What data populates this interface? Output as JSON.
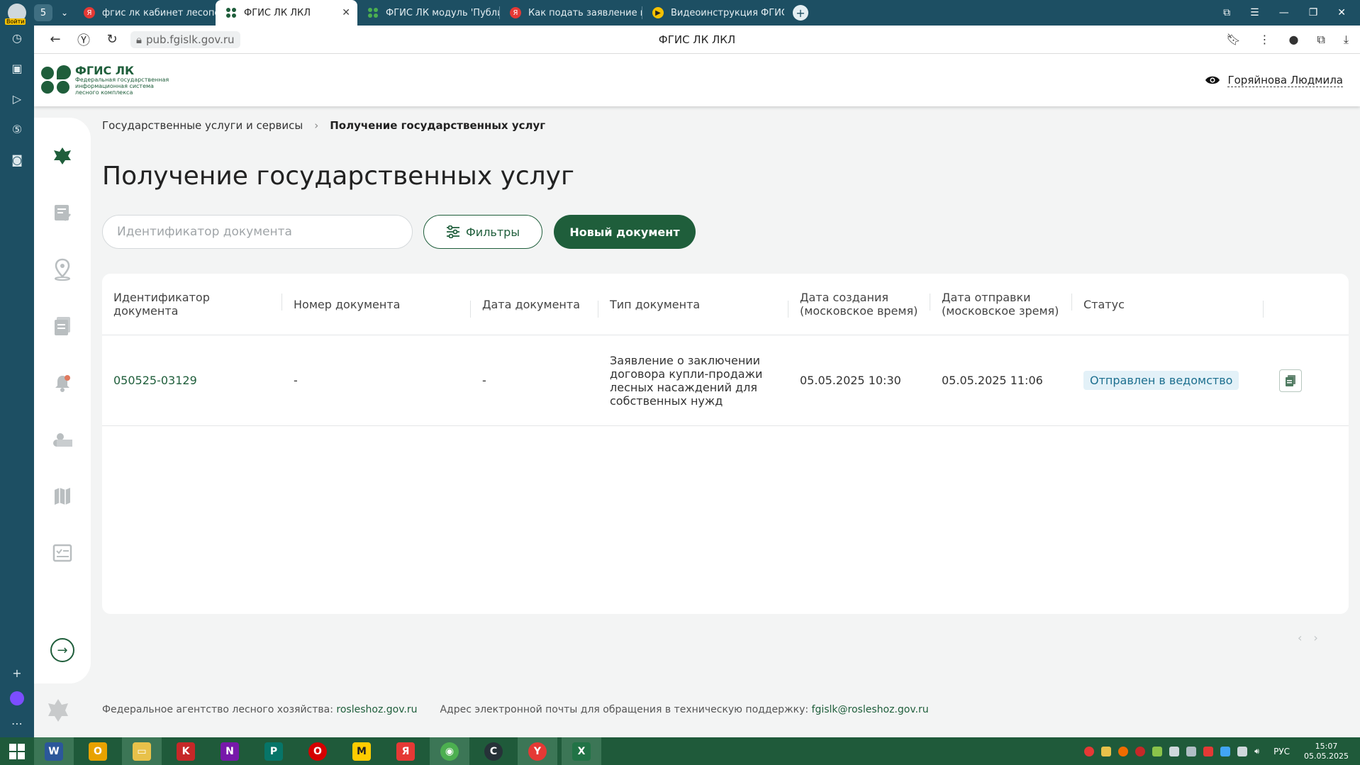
{
  "browser": {
    "profile_label": "Войти",
    "tab_count": "5",
    "tabs": [
      {
        "label": "фгис лк кабинет лесопол",
        "icon": "yandex-icon",
        "active": false
      },
      {
        "label": "ФГИС ЛК ЛКЛ",
        "icon": "fgis-icon",
        "active": true
      },
      {
        "label": "ФГИС ЛК модуль 'Публи",
        "icon": "fgis-icon",
        "active": false
      },
      {
        "label": "Как подать заявление на",
        "icon": "yandex-icon",
        "active": false
      },
      {
        "label": "Видеоинструкция ФГИС",
        "icon": "video-icon",
        "active": false
      }
    ],
    "url": "pub.fgislk.gov.ru",
    "page_title": "ФГИС ЛК ЛКЛ"
  },
  "header": {
    "logo_title": "ФГИС ЛК",
    "logo_subtitle": "Федеральная государственная информационная система лесного комплекса",
    "user_name": "Горяйнова Людмила"
  },
  "breadcrumb": {
    "parent": "Государственные услуги и сервисы",
    "current": "Получение государственных услуг"
  },
  "page": {
    "title": "Получение государственных услуг",
    "search_placeholder": "Идентификатор документа",
    "filters_label": "Фильтры",
    "new_document_label": "Новый документ"
  },
  "table": {
    "columns": [
      "Идентификатор документа",
      "Номер документа",
      "Дата документа",
      "Тип документа",
      "Дата создания (московское время)",
      "Дата отправки (московское зремя)",
      "Статус"
    ],
    "rows": [
      {
        "id": "050525-03129",
        "number": "-",
        "date": "-",
        "type": "Заявление о заключении договора купли-продажи лесных насаждений для собственных нужд",
        "created": "05.05.2025 10:30",
        "sent": "05.05.2025 11:06",
        "status": "Отправлен в ведомство"
      }
    ]
  },
  "footer": {
    "agency_label": "Федеральное агентство лесного хозяйства:",
    "agency_link": "rosleshoz.gov.ru",
    "support_label": "Адрес электронной почты для обращения в техническую поддержку:",
    "support_email": "fgislk@rosleshoz.gov.ru"
  },
  "taskbar": {
    "language": "РУС",
    "time": "15:07",
    "date": "05.05.2025"
  },
  "colors": {
    "brand_green": "#1f5e3b",
    "browser_teal": "#1d4f63",
    "status_blue": "#1d6f8f"
  }
}
